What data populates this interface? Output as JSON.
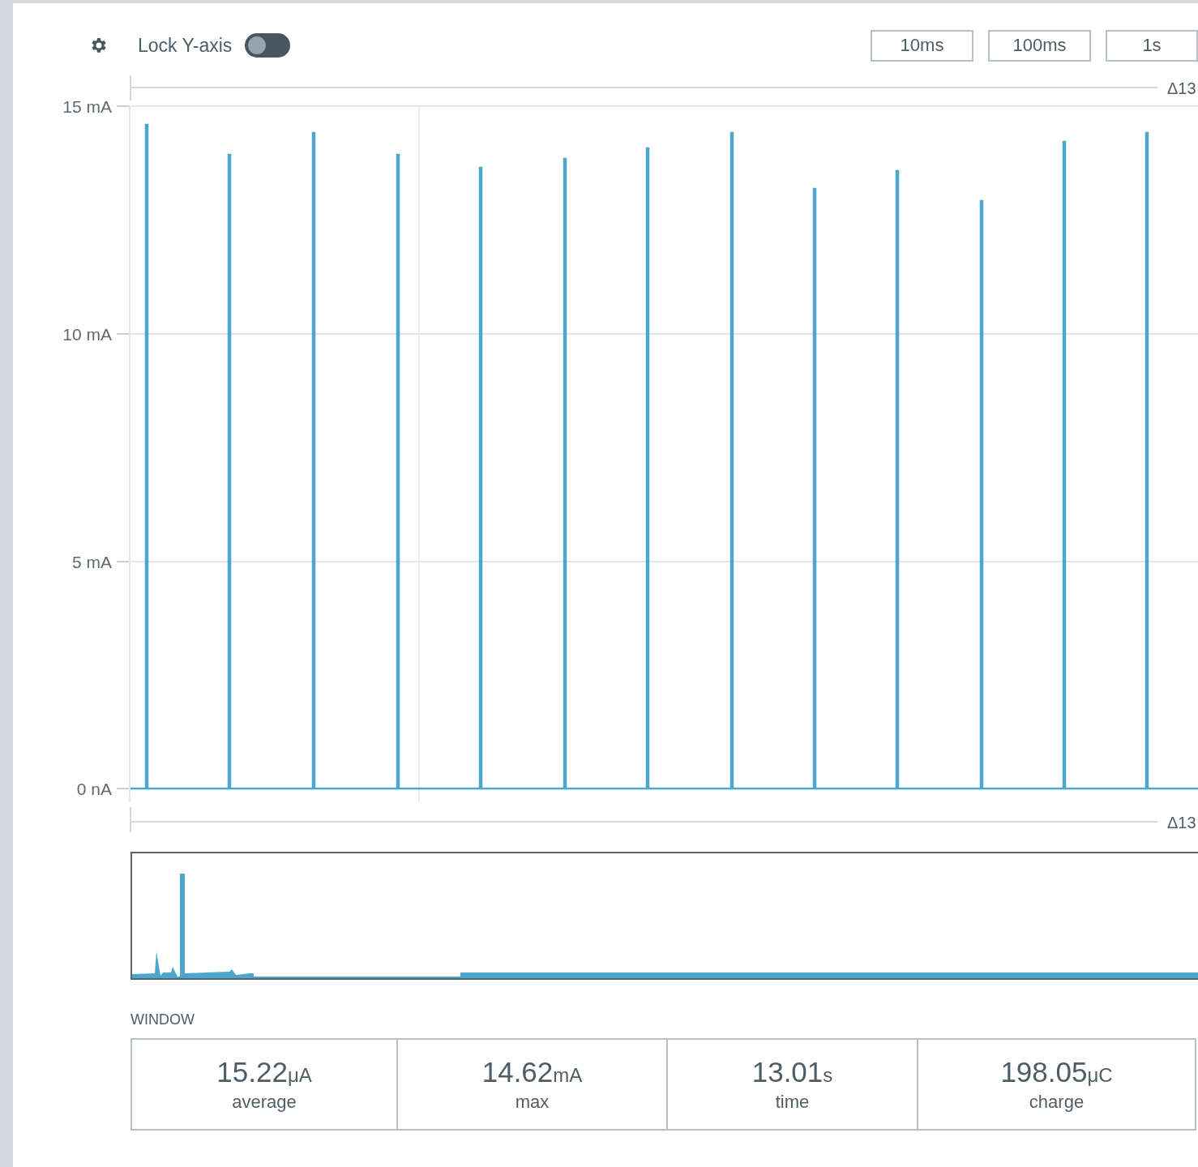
{
  "toolbar": {
    "lock_y_axis": {
      "label": "Lock Y-axis",
      "on": false
    },
    "time_buttons": [
      "10ms",
      "100ms",
      "1s"
    ]
  },
  "chart": {
    "span_label_top": "Δ13",
    "y_axis_labels": [
      "15 mA",
      "10 mA",
      "5 mA",
      "0 nA"
    ],
    "span_label_bottom": "Δ13"
  },
  "window_stats": {
    "title": "WINDOW",
    "items": [
      {
        "value": "15.22",
        "unit": "μA",
        "label": "average"
      },
      {
        "value": "14.62",
        "unit": "mA",
        "label": "max"
      },
      {
        "value": "13.01",
        "unit": "s",
        "label": "time"
      },
      {
        "value": "198.05",
        "unit": "μC",
        "label": "charge"
      }
    ]
  }
}
